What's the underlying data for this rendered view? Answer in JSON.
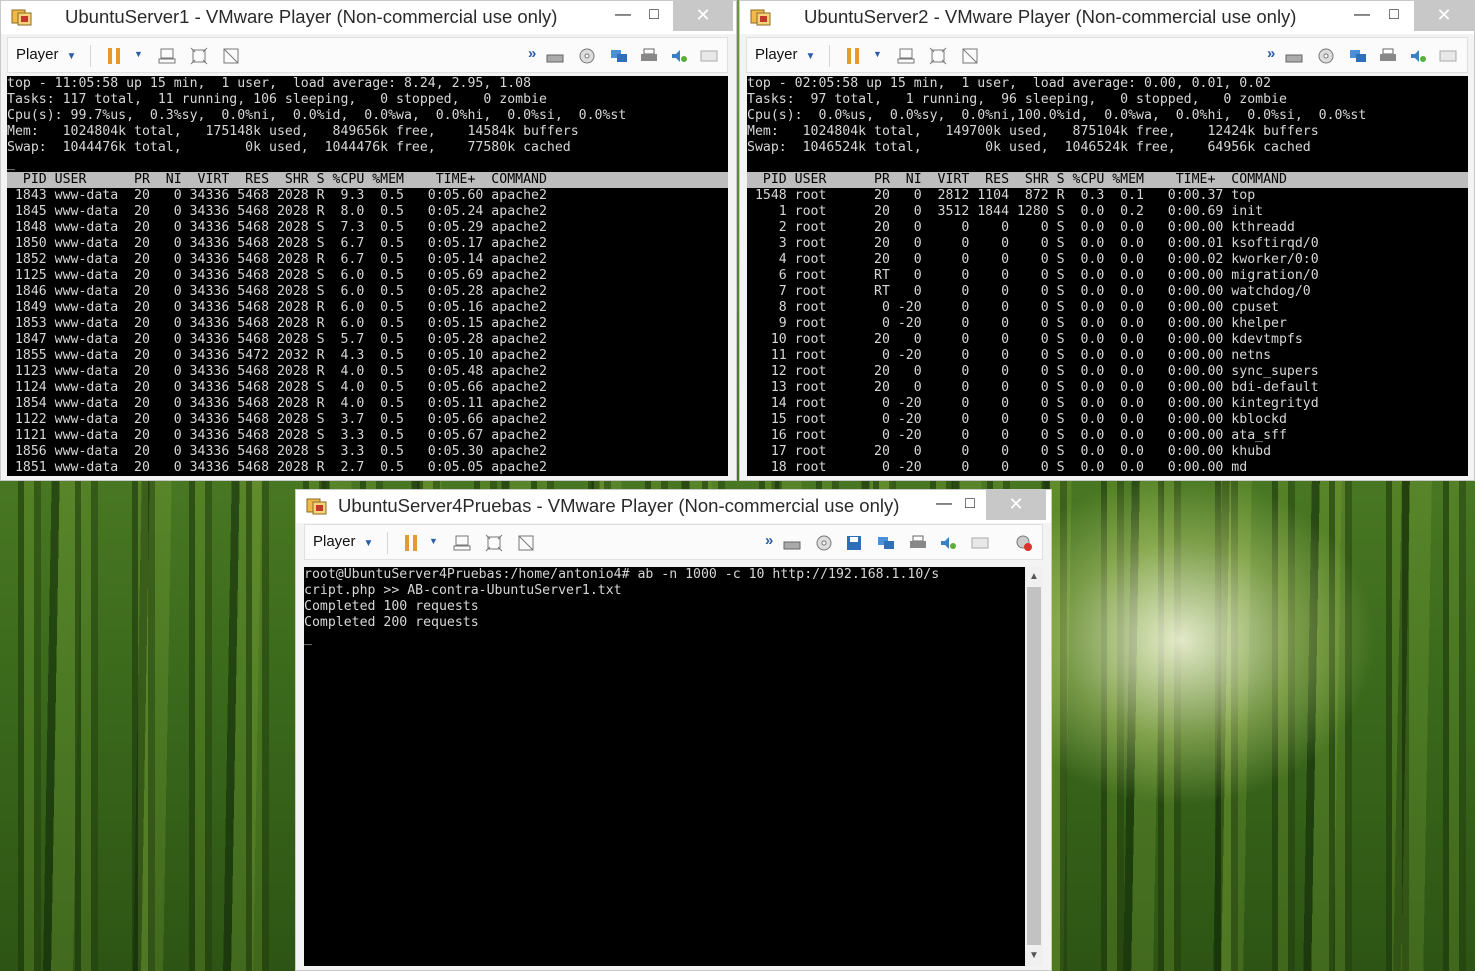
{
  "colors": {
    "terminal_bg": "#000000",
    "terminal_fg": "#d7d7d7",
    "header_bg": "#bdbdbd",
    "accent": "#e59a2e"
  },
  "windows": [
    {
      "title": "UbuntuServer1 - VMware Player (Non-commercial use only)",
      "player_label": "Player",
      "icons": [
        "vmware-app-icon",
        "minimize-icon",
        "maximize-icon",
        "close-icon"
      ],
      "terminal": {
        "summary": [
          "top - 11:05:58 up 15 min,  1 user,  load average: 8.24, 2.95, 1.08",
          "Tasks: 117 total,  11 running, 106 sleeping,   0 stopped,   0 zombie",
          "Cpu(s): 99.7%us,  0.3%sy,  0.0%ni,  0.0%id,  0.0%wa,  0.0%hi,  0.0%si,  0.0%st",
          "Mem:   1024804k total,   175148k used,   849656k free,    14584k buffers",
          "Swap:  1044476k total,        0k used,  1044476k free,    77580k cached",
          "_"
        ],
        "header": "  PID USER      PR  NI  VIRT  RES  SHR S %CPU %MEM    TIME+  COMMAND        ",
        "rows": [
          " 1843 www-data  20   0 34336 5468 2028 R  9.3  0.5   0:05.60 apache2",
          " 1845 www-data  20   0 34336 5468 2028 R  8.0  0.5   0:05.24 apache2",
          " 1848 www-data  20   0 34336 5468 2028 S  7.3  0.5   0:05.29 apache2",
          " 1850 www-data  20   0 34336 5468 2028 S  6.7  0.5   0:05.17 apache2",
          " 1852 www-data  20   0 34336 5468 2028 R  6.7  0.5   0:05.14 apache2",
          " 1125 www-data  20   0 34336 5468 2028 S  6.0  0.5   0:05.69 apache2",
          " 1846 www-data  20   0 34336 5468 2028 S  6.0  0.5   0:05.28 apache2",
          " 1849 www-data  20   0 34336 5468 2028 R  6.0  0.5   0:05.16 apache2",
          " 1853 www-data  20   0 34336 5468 2028 R  6.0  0.5   0:05.15 apache2",
          " 1847 www-data  20   0 34336 5468 2028 S  5.7  0.5   0:05.28 apache2",
          " 1855 www-data  20   0 34336 5472 2032 R  4.3  0.5   0:05.10 apache2",
          " 1123 www-data  20   0 34336 5468 2028 R  4.0  0.5   0:05.48 apache2",
          " 1124 www-data  20   0 34336 5468 2028 S  4.0  0.5   0:05.66 apache2",
          " 1854 www-data  20   0 34336 5468 2028 R  4.0  0.5   0:05.11 apache2",
          " 1122 www-data  20   0 34336 5468 2028 S  3.7  0.5   0:05.66 apache2",
          " 1121 www-data  20   0 34336 5468 2028 S  3.3  0.5   0:05.67 apache2",
          " 1856 www-data  20   0 34336 5468 2028 S  3.3  0.5   0:05.30 apache2",
          " 1851 www-data  20   0 34336 5468 2028 R  2.7  0.5   0:05.05 apache2"
        ]
      }
    },
    {
      "title": "UbuntuServer2 - VMware Player (Non-commercial use only)",
      "player_label": "Player",
      "terminal": {
        "summary": [
          "top - 02:05:58 up 15 min,  1 user,  load average: 0.00, 0.01, 0.02",
          "Tasks:  97 total,   1 running,  96 sleeping,   0 stopped,   0 zombie",
          "Cpu(s):  0.0%us,  0.0%sy,  0.0%ni,100.0%id,  0.0%wa,  0.0%hi,  0.0%si,  0.0%st",
          "Mem:   1024804k total,   149700k used,   875104k free,    12424k buffers",
          "Swap:  1046524k total,        0k used,  1046524k free,    64956k cached",
          ""
        ],
        "header": "  PID USER      PR  NI  VIRT  RES  SHR S %CPU %MEM    TIME+  COMMAND        ",
        "rows": [
          " 1548 root      20   0  2812 1104  872 R  0.3  0.1   0:00.37 top",
          "    1 root      20   0  3512 1844 1280 S  0.0  0.2   0:00.69 init",
          "    2 root      20   0     0    0    0 S  0.0  0.0   0:00.00 kthreadd",
          "    3 root      20   0     0    0    0 S  0.0  0.0   0:00.01 ksoftirqd/0",
          "    4 root      20   0     0    0    0 S  0.0  0.0   0:00.02 kworker/0:0",
          "    6 root      RT   0     0    0    0 S  0.0  0.0   0:00.00 migration/0",
          "    7 root      RT   0     0    0    0 S  0.0  0.0   0:00.00 watchdog/0",
          "    8 root       0 -20     0    0    0 S  0.0  0.0   0:00.00 cpuset",
          "    9 root       0 -20     0    0    0 S  0.0  0.0   0:00.00 khelper",
          "   10 root      20   0     0    0    0 S  0.0  0.0   0:00.00 kdevtmpfs",
          "   11 root       0 -20     0    0    0 S  0.0  0.0   0:00.00 netns",
          "   12 root      20   0     0    0    0 S  0.0  0.0   0:00.00 sync_supers",
          "   13 root      20   0     0    0    0 S  0.0  0.0   0:00.00 bdi-default",
          "   14 root       0 -20     0    0    0 S  0.0  0.0   0:00.00 kintegrityd",
          "   15 root       0 -20     0    0    0 S  0.0  0.0   0:00.00 kblockd",
          "   16 root       0 -20     0    0    0 S  0.0  0.0   0:00.00 ata_sff",
          "   17 root      20   0     0    0    0 S  0.0  0.0   0:00.00 khubd",
          "   18 root       0 -20     0    0    0 S  0.0  0.0   0:00.00 md"
        ]
      }
    },
    {
      "title": "UbuntuServer4Pruebas - VMware Player (Non-commercial use only)",
      "player_label": "Player",
      "terminal": {
        "lines": [
          "root@UbuntuServer4Pruebas:/home/antonio4# ab -n 1000 -c 10 http://192.168.1.10/s",
          "cript.php >> AB-contra-UbuntuServer1.txt",
          "Completed 100 requests",
          "Completed 200 requests",
          "_"
        ]
      }
    }
  ]
}
